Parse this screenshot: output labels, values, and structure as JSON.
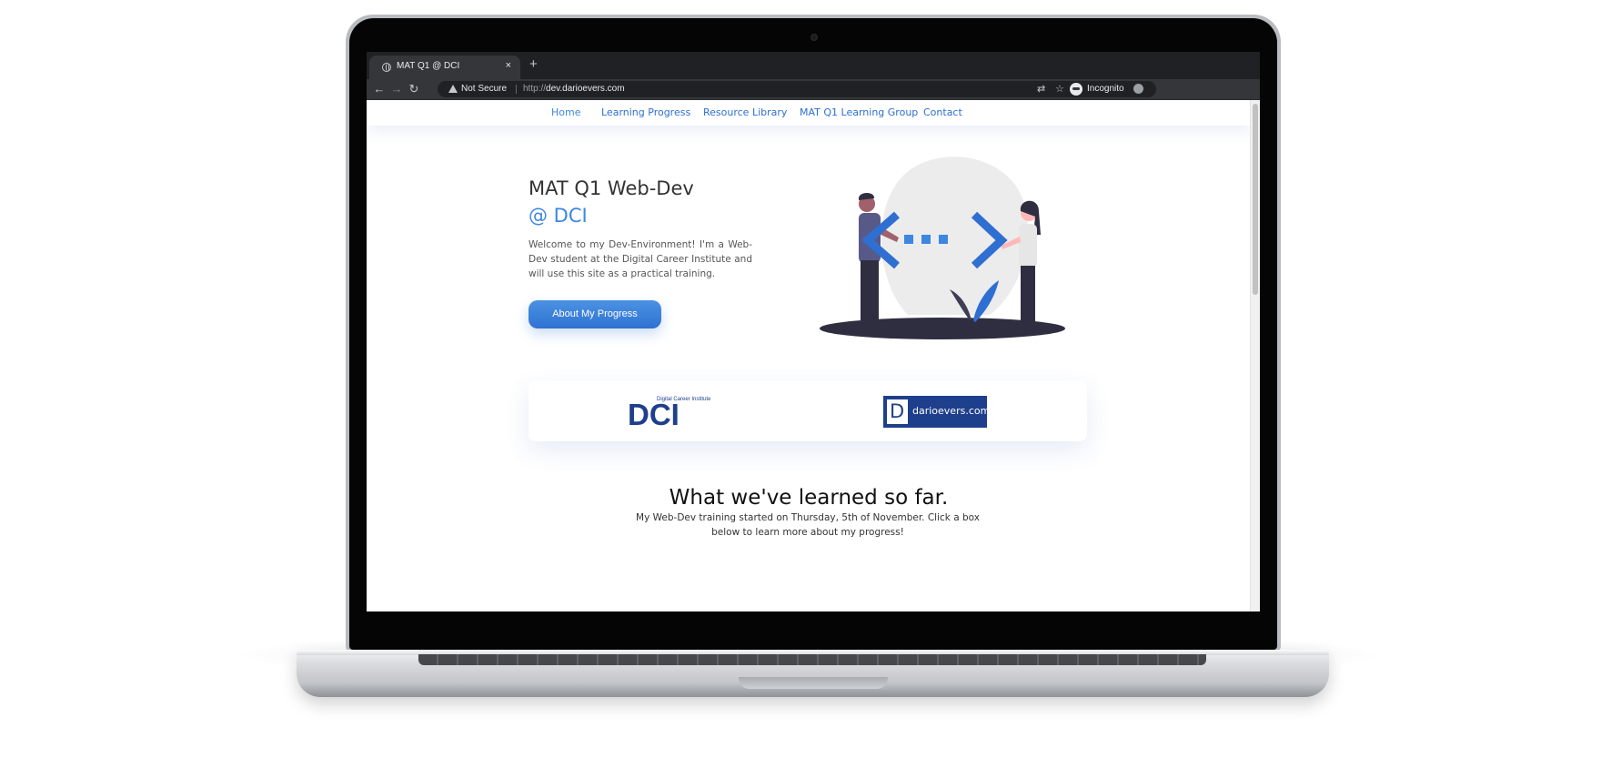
{
  "browser": {
    "tab_title": "MAT Q1 @ DCI",
    "tab_close": "×",
    "new_tab": "+",
    "security_label": "Not Secure",
    "url_protocol": "http://",
    "url_host": "dev.darioevers.com",
    "profile_label": "Incognito"
  },
  "nav": {
    "links": [
      "Home",
      "Learning Progress",
      "Resource Library",
      "MAT Q1 Learning Group",
      "Contact"
    ]
  },
  "hero": {
    "title": "MAT Q1 Web-Dev",
    "subtitle": "@ DCI",
    "text": "Welcome to my Dev-Environment! I'm a Web-Dev student at the Digital Career Institute and will use this site as a practical training.",
    "button": "About My Progress"
  },
  "logos": {
    "dci_mark": "DCI",
    "dci_tagline": "Digital Career Institute",
    "dario_initial": "D",
    "dario_text": "darioevers.com"
  },
  "section": {
    "title": "What we've learned so far.",
    "text": "My Web-Dev training started on Thursday, 5th of November. Click a box below to learn more about my progress!"
  },
  "colors": {
    "accent": "#3d87e0",
    "nav_link": "#2d6fd0",
    "button": "#2f72d2",
    "brand_navy": "#1e3f8c",
    "chrome_dark": "#202124"
  },
  "icons": [
    "globe-icon",
    "back-arrow-icon",
    "forward-arrow-icon",
    "reload-icon",
    "warning-icon",
    "translate-icon",
    "star-icon",
    "incognito-icon",
    "menu-icon"
  ]
}
